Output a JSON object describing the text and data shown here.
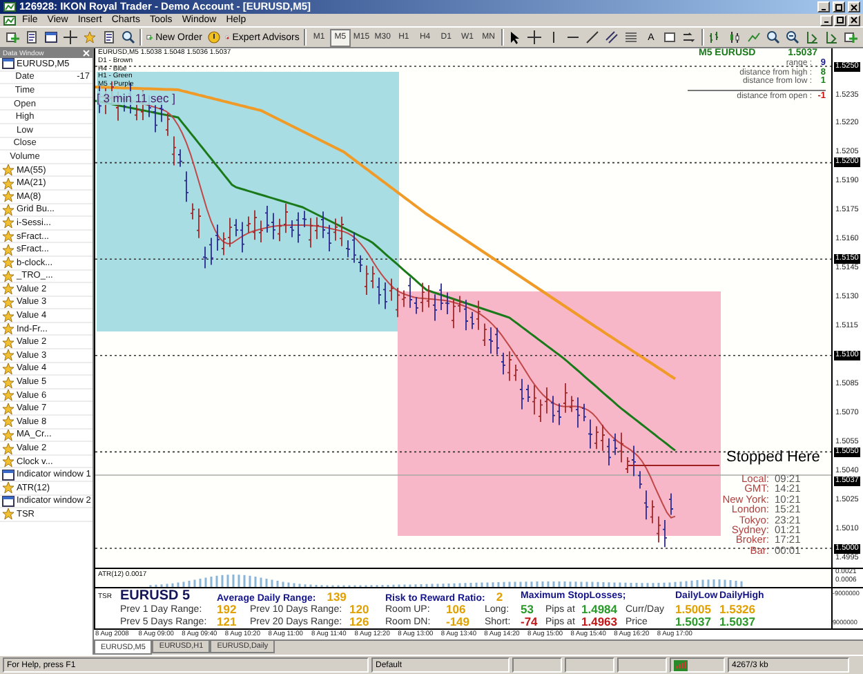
{
  "window": {
    "title": "126928: IKON Royal Trader - Demo Account - [EURUSD,M5]"
  },
  "menu": [
    "File",
    "View",
    "Insert",
    "Charts",
    "Tools",
    "Window",
    "Help"
  ],
  "toolbar": {
    "new_order": "New Order",
    "expert_advisors": "Expert Advisors",
    "text_tool": "A",
    "timeframes": [
      {
        "label": "M1",
        "selected": false
      },
      {
        "label": "M5",
        "selected": true
      },
      {
        "label": "M15",
        "selected": false
      },
      {
        "label": "M30",
        "selected": false
      },
      {
        "label": "H1",
        "selected": false
      },
      {
        "label": "H4",
        "selected": false
      },
      {
        "label": "D1",
        "selected": false
      },
      {
        "label": "W1",
        "selected": false
      },
      {
        "label": "MN",
        "selected": false
      }
    ]
  },
  "data_window": {
    "title": "Data Window",
    "rows": [
      {
        "kind": "symbol",
        "label": "EURUSD,M5"
      },
      {
        "kind": "field",
        "label": "Date",
        "value": "-17"
      },
      {
        "kind": "field",
        "label": "Time"
      },
      {
        "kind": "field",
        "label": "Open"
      },
      {
        "kind": "field",
        "label": "High"
      },
      {
        "kind": "field",
        "label": "Low"
      },
      {
        "kind": "field",
        "label": "Close"
      },
      {
        "kind": "field",
        "label": "Volume"
      },
      {
        "kind": "indicator",
        "label": "MA(55)"
      },
      {
        "kind": "indicator",
        "label": "MA(21)"
      },
      {
        "kind": "indicator",
        "label": "MA(8)"
      },
      {
        "kind": "indicator",
        "label": "Grid Bu..."
      },
      {
        "kind": "indicator",
        "label": "i-Sessi..."
      },
      {
        "kind": "indicator",
        "label": "sFract..."
      },
      {
        "kind": "indicator",
        "label": "sFract..."
      },
      {
        "kind": "indicator",
        "label": "b-clock..."
      },
      {
        "kind": "indicator",
        "label": "_TRO_..."
      },
      {
        "kind": "indicator",
        "label": "Value 2"
      },
      {
        "kind": "indicator",
        "label": "Value 3"
      },
      {
        "kind": "indicator",
        "label": "Value 4"
      },
      {
        "kind": "indicator",
        "label": "Ind-Fr..."
      },
      {
        "kind": "indicator",
        "label": "Value 2"
      },
      {
        "kind": "indicator",
        "label": "Value 3"
      },
      {
        "kind": "indicator",
        "label": "Value 4"
      },
      {
        "kind": "indicator",
        "label": "Value 5"
      },
      {
        "kind": "indicator",
        "label": "Value 6"
      },
      {
        "kind": "indicator",
        "label": "Value 7"
      },
      {
        "kind": "indicator",
        "label": "Value 8"
      },
      {
        "kind": "indicator",
        "label": "MA_Cr..."
      },
      {
        "kind": "indicator",
        "label": "Value 2"
      },
      {
        "kind": "indicator",
        "label": "Clock v..."
      },
      {
        "kind": "window",
        "label": "Indicator window 1"
      },
      {
        "kind": "indicator",
        "label": "ATR(12)"
      },
      {
        "kind": "window",
        "label": "Indicator window 2"
      },
      {
        "kind": "indicator",
        "label": "TSR"
      }
    ]
  },
  "chart": {
    "ohlc": "EURUSD,M5  1.5038 1.5048 1.5036 1.5037",
    "legend": [
      "D1 - Brown",
      "H4 - Blue",
      "H1 - Green",
      "M5 - Purple"
    ],
    "timer": "[ 3 min 11 sec ]",
    "quote": {
      "symbol": "M5 EURUSD",
      "price": "1.5037",
      "rows": [
        {
          "label": "range :",
          "value": "9",
          "color": "#1a1a8a"
        },
        {
          "label": "distance from high :",
          "value": "8",
          "color": "#1a7a1a"
        },
        {
          "label": "distance from low :",
          "value": "1",
          "color": "#1a7a1a"
        }
      ],
      "open_row": {
        "label": "distance from open :",
        "value": "-1",
        "color": "#c01010"
      }
    },
    "stop_label": "Stopped Here",
    "clocks": [
      {
        "label": "Local:",
        "value": "09:21"
      },
      {
        "label": "GMT:",
        "value": "14:21"
      },
      {
        "label": "New York:",
        "value": "10:21"
      },
      {
        "label": "London:",
        "value": "15:21"
      },
      {
        "label": "Tokyo:",
        "value": "23:21"
      },
      {
        "label": "Sydney:",
        "value": "01:21"
      },
      {
        "label": "Broker:",
        "value": "17:21"
      },
      {
        "label": "Bar:",
        "value": "00:01"
      }
    ],
    "price_ticks": [
      [
        "1.5235",
        "1.5220",
        "1.5205",
        "1.5190",
        "1.5175",
        "1.5160",
        "1.5145",
        "1.5130",
        "1.5115"
      ],
      [
        "1.5085",
        "1.5070",
        "1.5055",
        "1.5040",
        "1.5025",
        "1.5010",
        "1.4995"
      ]
    ],
    "price_levels": [
      "1.5250",
      "1.5200",
      "1.5150",
      "1.5100",
      "1.5050",
      "1.5000"
    ],
    "current_price": "1.5037"
  },
  "atr": {
    "label": "ATR(12) 0.0017",
    "ticks": [
      "0.0021",
      "0.0006"
    ]
  },
  "info_panel": {
    "tag": "TSR",
    "symbol": "EURUSD 5",
    "headers": [
      {
        "label": "Average Daily Range:",
        "value": "139"
      },
      {
        "label": "Risk to Reward Ratio:",
        "value": "2"
      },
      {
        "label": "Maximum StopLosses;"
      },
      {
        "label": "DailyLow"
      },
      {
        "label": "DailyHigh"
      }
    ],
    "rows": [
      [
        {
          "kind": "label",
          "text": "Prev 1 Day Range:"
        },
        {
          "kind": "value",
          "text": "192"
        },
        {
          "kind": "label",
          "text": "Prev 10 Days Range:"
        },
        {
          "kind": "value",
          "text": "120"
        },
        {
          "kind": "label",
          "text": "Room UP:"
        },
        {
          "kind": "value",
          "text": "106"
        },
        {
          "kind": "label",
          "text": "Long:"
        },
        {
          "kind": "gain",
          "text": "53"
        },
        {
          "kind": "label",
          "text": "Pips at"
        },
        {
          "kind": "gain",
          "text": "1.4984"
        },
        {
          "kind": "label",
          "text": "Curr/Day"
        },
        {
          "kind": "value",
          "text": "1.5005"
        },
        {
          "kind": "value",
          "text": "1.5326"
        }
      ],
      [
        {
          "kind": "label",
          "text": "Prev 5 Days Range:"
        },
        {
          "kind": "value",
          "text": "121"
        },
        {
          "kind": "label",
          "text": "Prev 20 Days Range:"
        },
        {
          "kind": "value",
          "text": "126"
        },
        {
          "kind": "label",
          "text": "Room DN:"
        },
        {
          "kind": "value",
          "text": "-149"
        },
        {
          "kind": "label",
          "text": "Short:"
        },
        {
          "kind": "loss",
          "text": "-74"
        },
        {
          "kind": "label",
          "text": "Pips at"
        },
        {
          "kind": "loss",
          "text": "1.4963"
        },
        {
          "kind": "label",
          "text": "Price"
        },
        {
          "kind": "gain",
          "text": "1.5037"
        },
        {
          "kind": "gain",
          "text": "1.5037"
        }
      ]
    ],
    "ticks": [
      "-9000000",
      "9000000"
    ]
  },
  "time_axis": [
    "8 Aug 2008",
    "8 Aug 09:00",
    "8 Aug 09:40",
    "8 Aug 10:20",
    "8 Aug 11:00",
    "8 Aug 11:40",
    "8 Aug 12:20",
    "8 Aug 13:00",
    "8 Aug 13:40",
    "8 Aug 14:20",
    "8 Aug 15:00",
    "8 Aug 15:40",
    "8 Aug 16:20",
    "8 Aug 17:00"
  ],
  "tabs": [
    {
      "label": "EURUSD,M5",
      "selected": true
    },
    {
      "label": "EURUSD,H1",
      "selected": false
    },
    {
      "label": "EURUSD,Daily",
      "selected": false
    }
  ],
  "status_bar": {
    "help": "For Help, press F1",
    "profile": "Default",
    "traffic": "4267/3 kb"
  }
}
